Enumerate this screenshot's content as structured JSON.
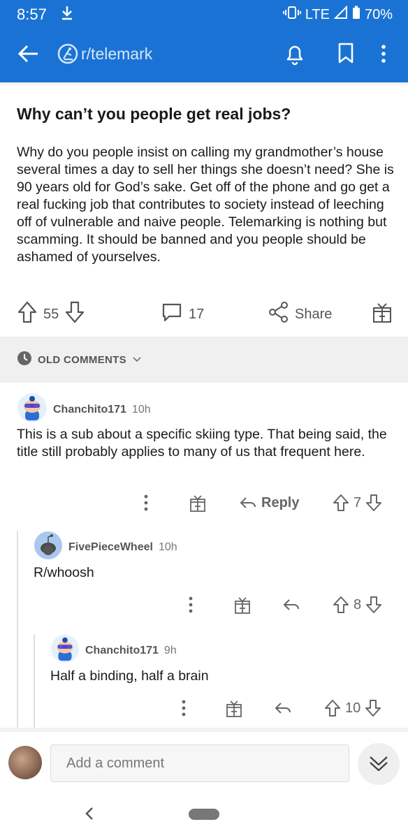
{
  "status": {
    "time": "8:57",
    "network": "LTE",
    "battery": "70%"
  },
  "header": {
    "subreddit": "r/telemark"
  },
  "post": {
    "title": "Why can’t you people get real jobs?",
    "body": "Why do you people insist on calling my grandmother’s house several times a day to sell her things she doesn’t need? She is 90 years old for God’s sake. Get off of the phone and go get a real fucking job that contributes to society instead of leeching off of vulnerable and naive people. Telemarking is nothing but scamming. It should be banned and you people should be ashamed of yourselves.",
    "votes": "55",
    "comments": "17",
    "share_label": "Share"
  },
  "sort": {
    "label": "OLD COMMENTS"
  },
  "comments": [
    {
      "author": "Chanchito171",
      "time": "10h",
      "text": "This is a sub about a specific skiing type. That being said, the title still probably applies to many of us that frequent here.",
      "votes": "7",
      "reply_label": "Reply"
    },
    {
      "author": "FivePieceWheel",
      "time": "10h",
      "text": "R/whoosh",
      "votes": "8"
    },
    {
      "author": "Chanchito171",
      "time": "9h",
      "text": "Half a binding, half a brain",
      "votes": "10"
    }
  ],
  "composer": {
    "placeholder": "Add a comment"
  },
  "colors": {
    "header_bg": "#1a73d4",
    "text": "#1a1a1b",
    "muted": "#666666"
  }
}
